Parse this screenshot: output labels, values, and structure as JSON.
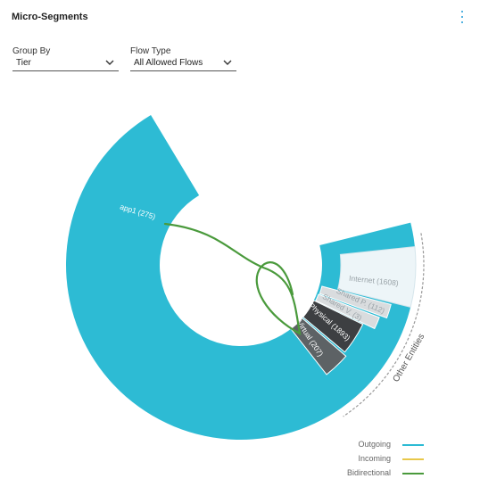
{
  "header": {
    "title": "Micro-Segments",
    "menu_icon": "kebab-vertical-icon"
  },
  "filters": {
    "group_by": {
      "label": "Group By",
      "value": "Tier"
    },
    "flow_type": {
      "label": "Flow Type",
      "value": "All Allowed Flows"
    }
  },
  "chart_data": {
    "type": "donut",
    "segments": [
      {
        "name": "app1",
        "label": "app1 (275)",
        "value": 275,
        "color": "#2dbbd4",
        "group": ""
      },
      {
        "name": "Internet",
        "label": "Internet (1608)",
        "value": 1608,
        "color": "#edf5f8",
        "group": "Other Entities"
      },
      {
        "name": "Shared P.",
        "label": "Shared P. (112)",
        "value": 112,
        "color": "#d9dcde",
        "group": "Other Entities"
      },
      {
        "name": "Shared V.",
        "label": "Shared V. (3)",
        "value": 3,
        "color": "#d9dcde",
        "group": "Other Entities"
      },
      {
        "name": "Physical",
        "label": "Physical (1893)",
        "value": 1893,
        "color": "#3d3f42",
        "group": "Other Entities"
      },
      {
        "name": "Virtual",
        "label": "Virtual (207)",
        "value": 207,
        "color": "#5d6265",
        "group": ""
      }
    ],
    "group_label": "Other Entities",
    "flows": [
      {
        "from": "app1",
        "to": "Physical",
        "type": "Bidirectional"
      }
    ],
    "legend": [
      {
        "label": "Outgoing",
        "color": "#2dbbd4"
      },
      {
        "label": "Incoming",
        "color": "#e8c84a"
      },
      {
        "label": "Bidirectional",
        "color": "#4a9a3c"
      }
    ]
  }
}
